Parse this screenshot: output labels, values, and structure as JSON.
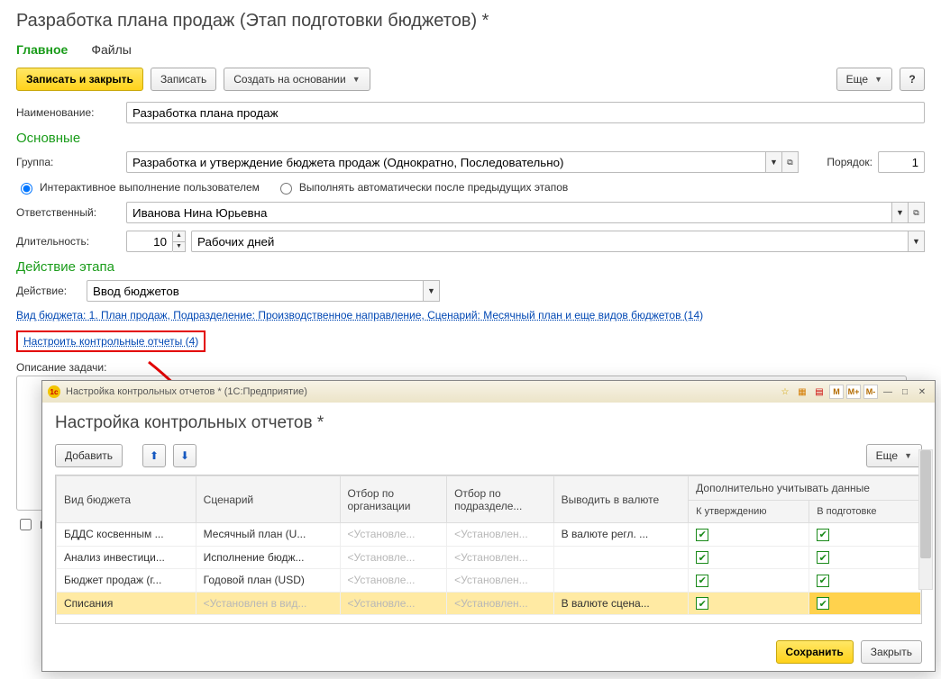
{
  "page": {
    "title": "Разработка плана продаж (Этап подготовки бюджетов) *"
  },
  "tabs": {
    "main": "Главное",
    "files": "Файлы"
  },
  "toolbar": {
    "saveclose": "Записать и закрыть",
    "save": "Записать",
    "createbased": "Создать на основании",
    "more": "Еще",
    "help": "?"
  },
  "fields": {
    "name_label": "Наименование:",
    "name_value": "Разработка плана продаж",
    "section_main": "Основные",
    "group_label": "Группа:",
    "group_value": "Разработка и утверждение бюджета продаж (Однократно, Последовательно)",
    "order_label": "Порядок:",
    "order_value": "1",
    "radio_interactive": "Интерактивное выполнение пользователем",
    "radio_auto": "Выполнять автоматически после предыдущих этапов",
    "responsible_label": "Ответственный:",
    "responsible_value": "Иванова Нина Юрьевна",
    "duration_label": "Длительность:",
    "duration_value": "10",
    "duration_unit": "Рабочих дней",
    "section_action": "Действие этапа",
    "action_label": "Действие:",
    "action_value": "Ввод бюджетов",
    "link_budgettype": "Вид бюджета: 1. План продаж, Подразделение: Производственное направление, Сценарий: Месячный план и еще видов бюджетов (14)",
    "link_reports": "Настроить контрольные отчеты (4)",
    "desc_label": "Описание задачи:",
    "chk_hidden": "Н"
  },
  "modal": {
    "wintitle": "Настройка контрольных отчетов *  (1С:Предприятие)",
    "title": "Настройка контрольных отчетов *",
    "add": "Добавить",
    "more": "Еще",
    "save": "Сохранить",
    "close": "Закрыть",
    "cols": {
      "c1": "Вид бюджета",
      "c2": "Сценарий",
      "c3": "Отбор по организации",
      "c4": "Отбор по подразделе...",
      "c5": "Выводить в валюте",
      "c6": "Дополнительно учитывать данные",
      "c6a": "К утверждению",
      "c6b": "В подготовке"
    },
    "rows": [
      {
        "c1": "БДДС косвенным ...",
        "c2": "Месячный план (U...",
        "c3": "<Установле...",
        "c4": "<Установлен...",
        "c5": "В валюте регл. ...",
        "a": true,
        "b": true
      },
      {
        "c1": "Анализ инвестици...",
        "c2": "Исполнение бюдж...",
        "c3": "<Установле...",
        "c4": "<Установлен...",
        "c5": "",
        "a": true,
        "b": true
      },
      {
        "c1": "Бюджет продаж (г...",
        "c2": "Годовой план (USD)",
        "c3": "<Установле...",
        "c4": "<Установлен...",
        "c5": "",
        "a": true,
        "b": true
      },
      {
        "c1": "Списания",
        "c2": "<Установлен в вид...",
        "c3": "<Установле...",
        "c4": "<Установлен...",
        "c5": "В валюте сцена...",
        "a": true,
        "b": true,
        "sel": true
      }
    ]
  }
}
